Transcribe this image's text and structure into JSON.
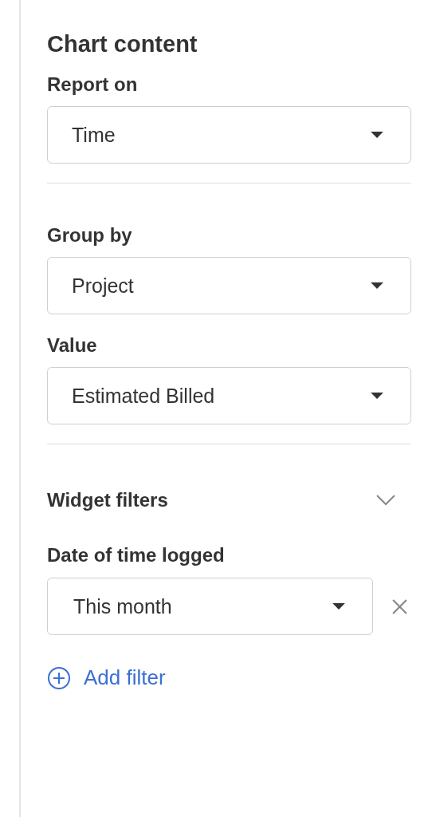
{
  "panel": {
    "title": "Chart content"
  },
  "sections": [
    {
      "fields": [
        {
          "label": "Report on",
          "value": "Time"
        }
      ]
    },
    {
      "fields": [
        {
          "label": "Group by",
          "value": "Project"
        },
        {
          "label": "Value",
          "value": "Estimated Billed"
        }
      ]
    }
  ],
  "widget_filters": {
    "title": "Widget filters",
    "expanded": true,
    "filters": [
      {
        "label": "Date of time logged",
        "value": "This month"
      }
    ],
    "add_filter": "Add filter"
  }
}
